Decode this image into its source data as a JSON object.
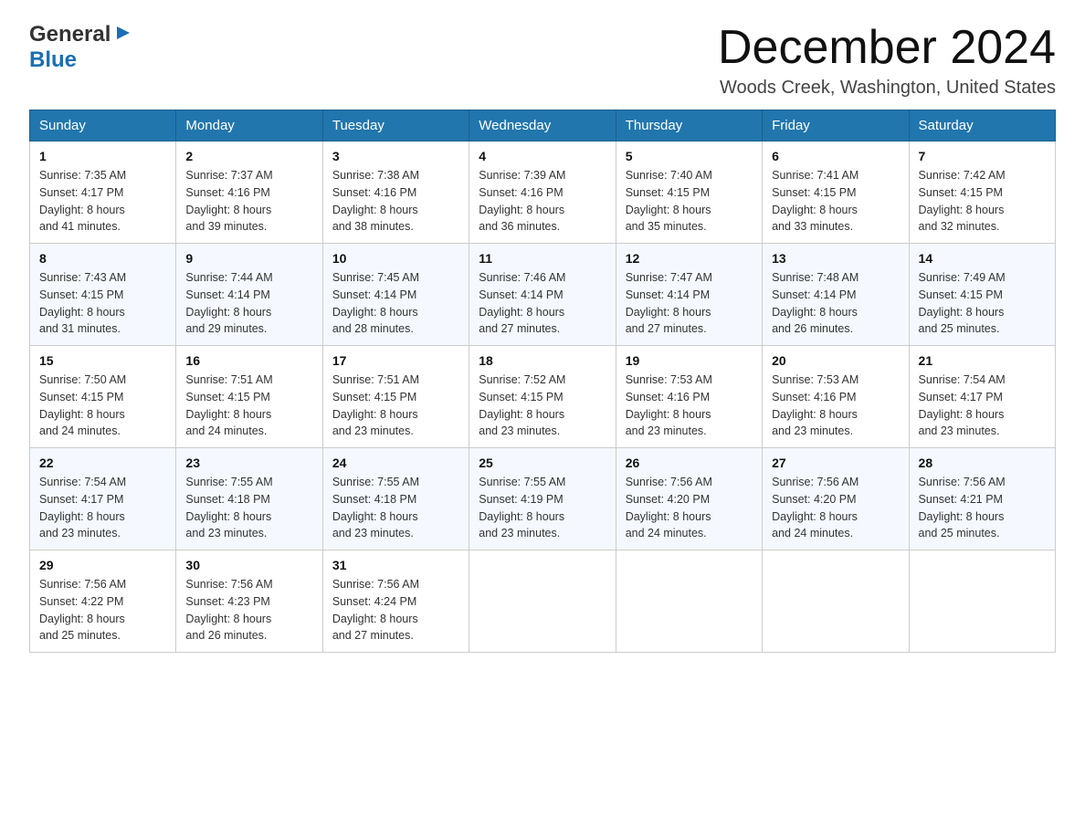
{
  "header": {
    "logo_line1": "General",
    "logo_line2": "Blue",
    "month_title": "December 2024",
    "location": "Woods Creek, Washington, United States"
  },
  "weekdays": [
    "Sunday",
    "Monday",
    "Tuesday",
    "Wednesday",
    "Thursday",
    "Friday",
    "Saturday"
  ],
  "weeks": [
    [
      {
        "day": "1",
        "sunrise": "7:35 AM",
        "sunset": "4:17 PM",
        "daylight": "8 hours and 41 minutes."
      },
      {
        "day": "2",
        "sunrise": "7:37 AM",
        "sunset": "4:16 PM",
        "daylight": "8 hours and 39 minutes."
      },
      {
        "day": "3",
        "sunrise": "7:38 AM",
        "sunset": "4:16 PM",
        "daylight": "8 hours and 38 minutes."
      },
      {
        "day": "4",
        "sunrise": "7:39 AM",
        "sunset": "4:16 PM",
        "daylight": "8 hours and 36 minutes."
      },
      {
        "day": "5",
        "sunrise": "7:40 AM",
        "sunset": "4:15 PM",
        "daylight": "8 hours and 35 minutes."
      },
      {
        "day": "6",
        "sunrise": "7:41 AM",
        "sunset": "4:15 PM",
        "daylight": "8 hours and 33 minutes."
      },
      {
        "day": "7",
        "sunrise": "7:42 AM",
        "sunset": "4:15 PM",
        "daylight": "8 hours and 32 minutes."
      }
    ],
    [
      {
        "day": "8",
        "sunrise": "7:43 AM",
        "sunset": "4:15 PM",
        "daylight": "8 hours and 31 minutes."
      },
      {
        "day": "9",
        "sunrise": "7:44 AM",
        "sunset": "4:14 PM",
        "daylight": "8 hours and 29 minutes."
      },
      {
        "day": "10",
        "sunrise": "7:45 AM",
        "sunset": "4:14 PM",
        "daylight": "8 hours and 28 minutes."
      },
      {
        "day": "11",
        "sunrise": "7:46 AM",
        "sunset": "4:14 PM",
        "daylight": "8 hours and 27 minutes."
      },
      {
        "day": "12",
        "sunrise": "7:47 AM",
        "sunset": "4:14 PM",
        "daylight": "8 hours and 27 minutes."
      },
      {
        "day": "13",
        "sunrise": "7:48 AM",
        "sunset": "4:14 PM",
        "daylight": "8 hours and 26 minutes."
      },
      {
        "day": "14",
        "sunrise": "7:49 AM",
        "sunset": "4:15 PM",
        "daylight": "8 hours and 25 minutes."
      }
    ],
    [
      {
        "day": "15",
        "sunrise": "7:50 AM",
        "sunset": "4:15 PM",
        "daylight": "8 hours and 24 minutes."
      },
      {
        "day": "16",
        "sunrise": "7:51 AM",
        "sunset": "4:15 PM",
        "daylight": "8 hours and 24 minutes."
      },
      {
        "day": "17",
        "sunrise": "7:51 AM",
        "sunset": "4:15 PM",
        "daylight": "8 hours and 23 minutes."
      },
      {
        "day": "18",
        "sunrise": "7:52 AM",
        "sunset": "4:15 PM",
        "daylight": "8 hours and 23 minutes."
      },
      {
        "day": "19",
        "sunrise": "7:53 AM",
        "sunset": "4:16 PM",
        "daylight": "8 hours and 23 minutes."
      },
      {
        "day": "20",
        "sunrise": "7:53 AM",
        "sunset": "4:16 PM",
        "daylight": "8 hours and 23 minutes."
      },
      {
        "day": "21",
        "sunrise": "7:54 AM",
        "sunset": "4:17 PM",
        "daylight": "8 hours and 23 minutes."
      }
    ],
    [
      {
        "day": "22",
        "sunrise": "7:54 AM",
        "sunset": "4:17 PM",
        "daylight": "8 hours and 23 minutes."
      },
      {
        "day": "23",
        "sunrise": "7:55 AM",
        "sunset": "4:18 PM",
        "daylight": "8 hours and 23 minutes."
      },
      {
        "day": "24",
        "sunrise": "7:55 AM",
        "sunset": "4:18 PM",
        "daylight": "8 hours and 23 minutes."
      },
      {
        "day": "25",
        "sunrise": "7:55 AM",
        "sunset": "4:19 PM",
        "daylight": "8 hours and 23 minutes."
      },
      {
        "day": "26",
        "sunrise": "7:56 AM",
        "sunset": "4:20 PM",
        "daylight": "8 hours and 24 minutes."
      },
      {
        "day": "27",
        "sunrise": "7:56 AM",
        "sunset": "4:20 PM",
        "daylight": "8 hours and 24 minutes."
      },
      {
        "day": "28",
        "sunrise": "7:56 AM",
        "sunset": "4:21 PM",
        "daylight": "8 hours and 25 minutes."
      }
    ],
    [
      {
        "day": "29",
        "sunrise": "7:56 AM",
        "sunset": "4:22 PM",
        "daylight": "8 hours and 25 minutes."
      },
      {
        "day": "30",
        "sunrise": "7:56 AM",
        "sunset": "4:23 PM",
        "daylight": "8 hours and 26 minutes."
      },
      {
        "day": "31",
        "sunrise": "7:56 AM",
        "sunset": "4:24 PM",
        "daylight": "8 hours and 27 minutes."
      },
      null,
      null,
      null,
      null
    ]
  ],
  "labels": {
    "sunrise": "Sunrise:",
    "sunset": "Sunset:",
    "daylight": "Daylight:"
  }
}
